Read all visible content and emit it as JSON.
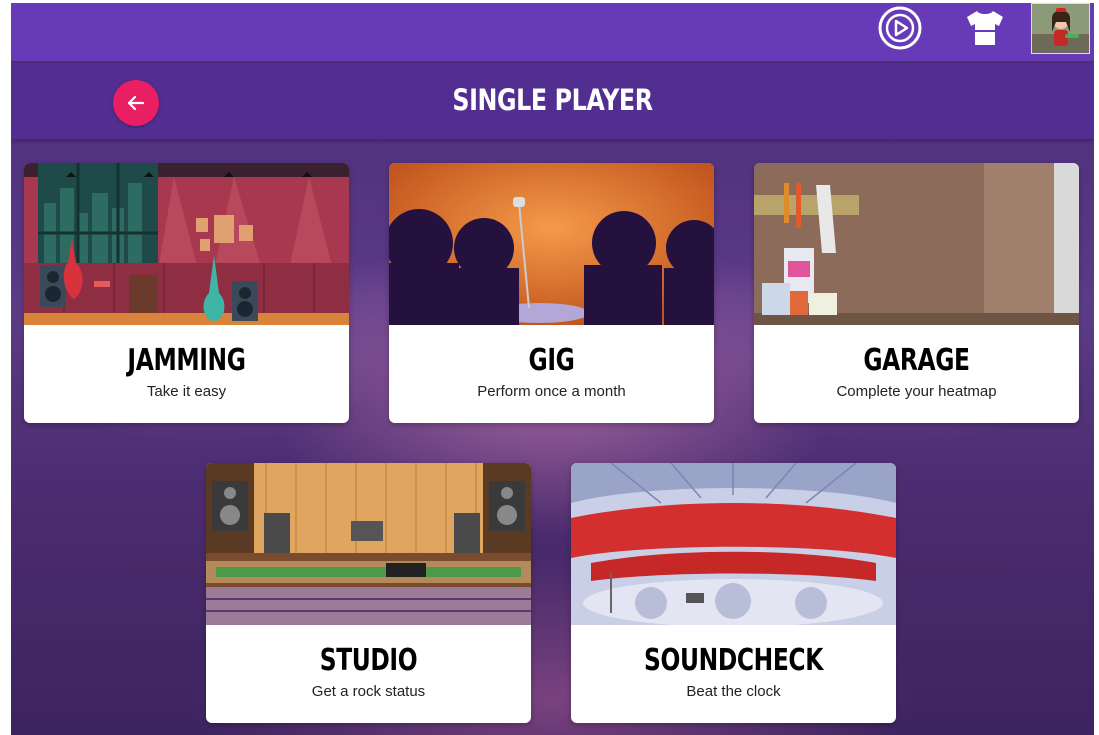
{
  "header": {
    "play_icon": "play-circle-icon",
    "shirt_icon": "tshirt-icon",
    "avatar": "user-avatar"
  },
  "page": {
    "title": "SINGLE PLAYER",
    "back_icon": "arrow-left-icon"
  },
  "colors": {
    "topbar": "#673ab7",
    "titlebar": "#522e91",
    "back_button": "#e91e63"
  },
  "cards": [
    {
      "id": "jamming",
      "title": "JAMMING",
      "subtitle": "Take it easy"
    },
    {
      "id": "gig",
      "title": "GIG",
      "subtitle": "Perform once a month"
    },
    {
      "id": "garage",
      "title": "GARAGE",
      "subtitle": "Complete your heatmap"
    },
    {
      "id": "studio",
      "title": "STUDIO",
      "subtitle": "Get a rock status"
    },
    {
      "id": "soundcheck",
      "title": "SOUNDCHECK",
      "subtitle": "Beat the clock"
    }
  ]
}
